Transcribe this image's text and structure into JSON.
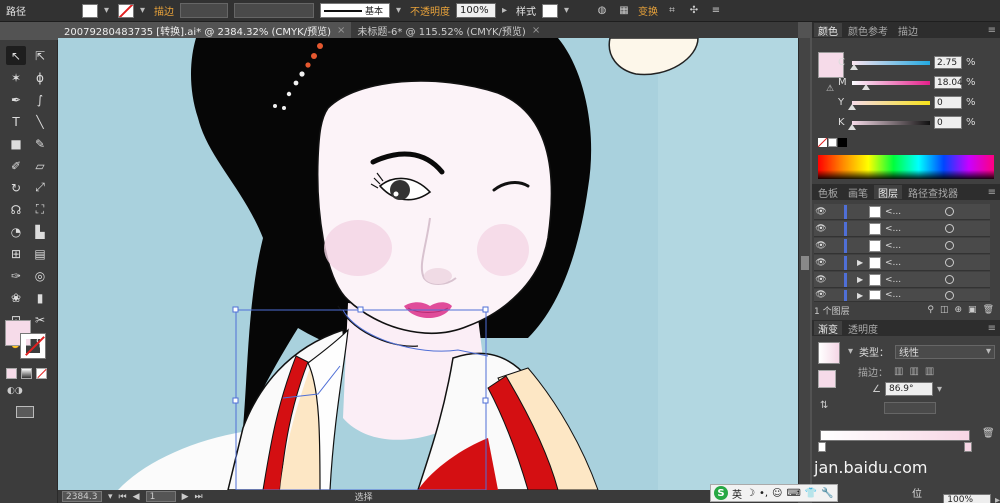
{
  "control_bar": {
    "mode_label": "路径",
    "stroke_label": "描边",
    "stroke_style": "基本",
    "opacity_label": "不透明度",
    "opacity_value": "100%",
    "style_label": "样式",
    "transform_label": "变换"
  },
  "tabs": [
    {
      "label": "20079280483735 [转换].ai* @ 2384.32% (CMYK/预览)",
      "close": "×"
    },
    {
      "label": "未标题-6* @ 115.52% (CMYK/预览)",
      "close": "×"
    }
  ],
  "status_bar": {
    "zoom": "2384.3",
    "page": "1",
    "tool_label": "选择"
  },
  "color_panel": {
    "tabs": [
      "颜色",
      "颜色参考",
      "描边"
    ],
    "channels": [
      {
        "name": "C",
        "value": "2.75",
        "fill": 0.03
      },
      {
        "name": "M",
        "value": "18.04",
        "fill": 0.18
      },
      {
        "name": "Y",
        "value": "0",
        "fill": 0
      },
      {
        "name": "K",
        "value": "0",
        "fill": 0
      }
    ],
    "unit": "%",
    "current_color": "#f6dbe9"
  },
  "layers_panel": {
    "tabs": [
      "色板",
      "画笔",
      "图层",
      "路径查找器"
    ],
    "rows": [
      {
        "name": "<...",
        "has_arrow": false
      },
      {
        "name": "<...",
        "has_arrow": false
      },
      {
        "name": "<...",
        "has_arrow": false
      },
      {
        "name": "<...",
        "has_arrow": true
      },
      {
        "name": "<...",
        "has_arrow": true
      },
      {
        "name": "<...",
        "has_arrow": true
      }
    ],
    "count_label": "1 个图层"
  },
  "gradient_panel": {
    "tabs": [
      "渐变",
      "透明度"
    ],
    "type_label": "类型：",
    "type_value": "线性",
    "stroke_label": "描边：",
    "angle_value": "86.9°",
    "position_label": "位置：",
    "position_value": "100%"
  },
  "ime": {
    "logo": "S",
    "lang": "英"
  },
  "watermark": "jan.baidu.com"
}
